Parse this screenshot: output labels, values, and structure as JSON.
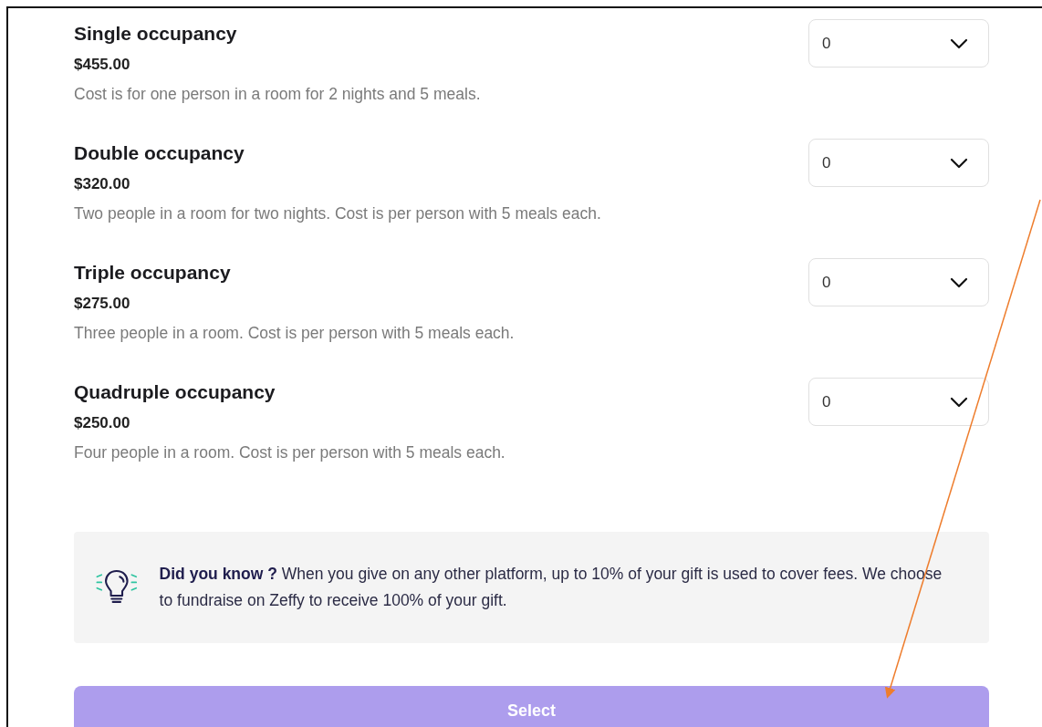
{
  "options": [
    {
      "title": "Single occupancy",
      "price": "$455.00",
      "description": "Cost is for one person in a room for 2 nights and 5 meals.",
      "quantity": "0"
    },
    {
      "title": "Double occupancy",
      "price": "$320.00",
      "description": "Two people in a room for two nights. Cost is per person with 5 meals each.",
      "quantity": "0"
    },
    {
      "title": "Triple occupancy",
      "price": "$275.00",
      "description": "Three people in a room. Cost is per person with 5 meals each.",
      "quantity": "0"
    },
    {
      "title": "Quadruple occupancy",
      "price": "$250.00",
      "description": "Four people in a room. Cost is per person with 5 meals each.",
      "quantity": "0"
    }
  ],
  "tip": {
    "text": "**Did you know ?** When you give on any other platform, up to 10% of your gift is used to cover fees. We choose to fundraise on Zeffy to receive 100% of your gift."
  },
  "select_button": {
    "label": "Select",
    "disabled": true
  }
}
